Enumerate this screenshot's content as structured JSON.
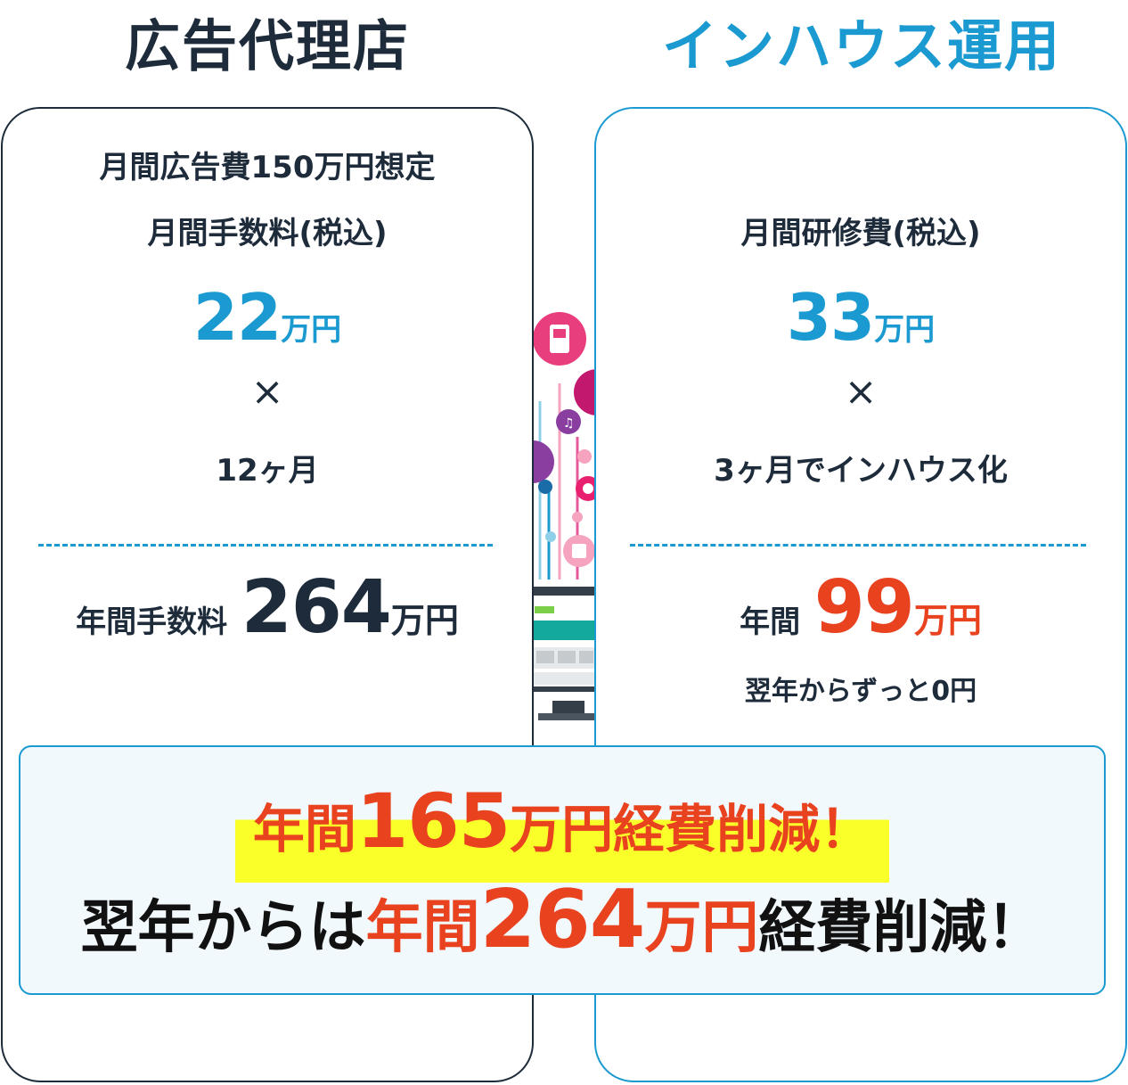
{
  "left": {
    "heading": "広告代理店",
    "line1": "月間広告費150万円想定",
    "line2": "月間手数料(税込)",
    "fee_value": "22",
    "fee_unit": "万円",
    "times": "×",
    "months": "12ヶ月",
    "annual_label": "年間手数料",
    "annual_value": "264",
    "annual_unit": "万円"
  },
  "right": {
    "heading": "インハウス運用",
    "line2": "月間研修費(税込)",
    "fee_value": "33",
    "fee_unit": "万円",
    "times": "×",
    "months": "3ヶ月でインハウス化",
    "annual_label": "年間",
    "annual_value": "99",
    "annual_unit": "万円",
    "note": "翌年からずっと0円"
  },
  "summary": {
    "line1_prefix": "年間",
    "line1_value": "165",
    "line1_suffix": "万円経費削減！",
    "line2_prefix": "翌年からは",
    "line2_red_prefix": "年間",
    "line2_value": "264",
    "line2_red_unit": "万円",
    "line2_suffix": "経費削減！"
  },
  "colors": {
    "navy": "#1d2b3a",
    "blue": "#1a9ad0",
    "red": "#e8421f",
    "highlight": "#faff2a"
  }
}
